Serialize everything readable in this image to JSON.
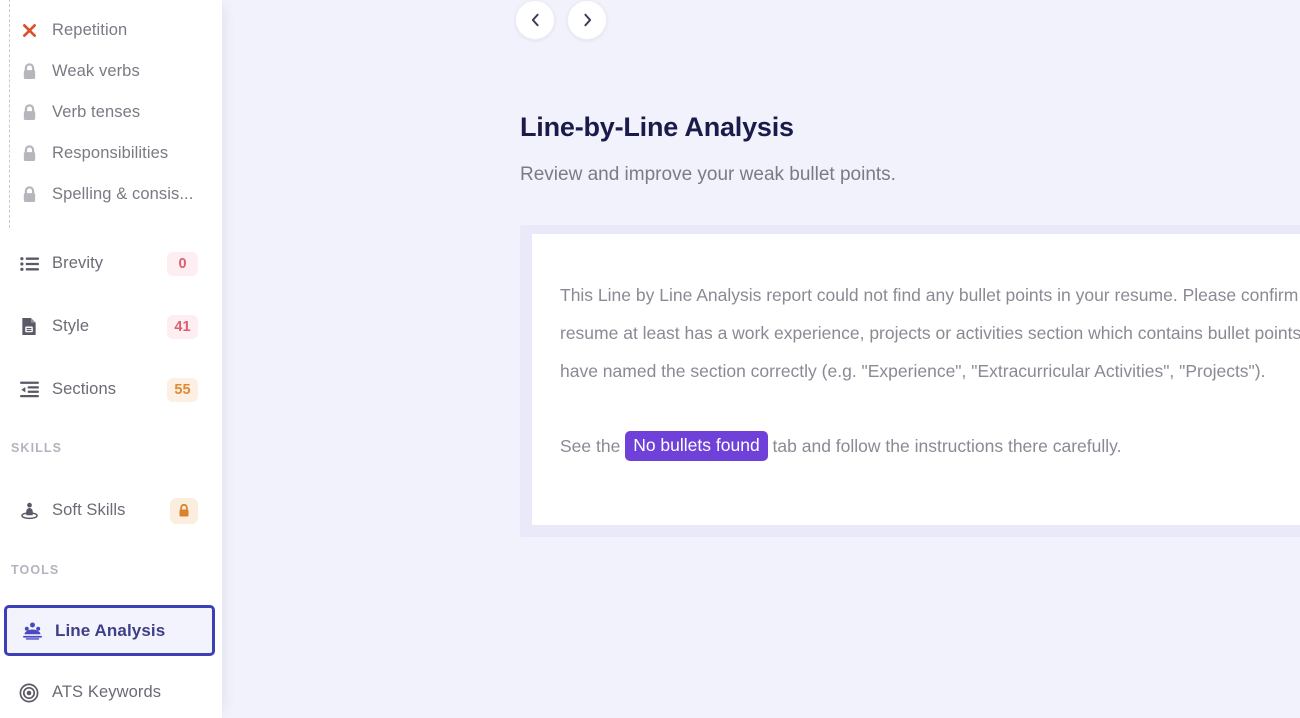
{
  "sidebar": {
    "locked_group": [
      {
        "label": "Repetition",
        "icon": "x-mark-icon",
        "state": "error"
      },
      {
        "label": "Weak verbs",
        "icon": "lock-icon",
        "state": "locked"
      },
      {
        "label": "Verb tenses",
        "icon": "lock-icon",
        "state": "locked"
      },
      {
        "label": "Responsibilities",
        "icon": "lock-icon",
        "state": "locked"
      },
      {
        "label": "Spelling & consis...",
        "icon": "lock-icon",
        "state": "locked"
      }
    ],
    "score_group": [
      {
        "label": "Brevity",
        "icon": "bulleted-list-icon",
        "badge": "0",
        "badge_style": "pink"
      },
      {
        "label": "Style",
        "icon": "document-icon",
        "badge": "41",
        "badge_style": "pink"
      },
      {
        "label": "Sections",
        "icon": "indent-icon",
        "badge": "55",
        "badge_style": "orange"
      }
    ],
    "skills_header": "SKILLS",
    "skills_group": [
      {
        "label": "Soft Skills",
        "icon": "person-pin-icon",
        "badge": "lock-icon",
        "badge_style": "lockbox"
      }
    ],
    "tools_header": "TOOLS",
    "tools_group": [
      {
        "label": "Line Analysis",
        "icon": "line-analysis-icon",
        "selected": true
      },
      {
        "label": "ATS Keywords",
        "icon": "target-icon",
        "selected": false
      }
    ]
  },
  "nav": {
    "prev_icon": "chevron-left-icon",
    "next_icon": "chevron-right-icon"
  },
  "header": {
    "title": "Line-by-Line Analysis",
    "subtitle": "Review and improve your weak bullet points."
  },
  "card": {
    "paragraph_1": "This Line by Line Analysis report could not find any bullet points in your resume. Please confirm that your resume at least has a work experience, projects or activities section which contains bullet points, and that you have named the section correctly (e.g. \"Experience\", \"Extracurricular Activities\", \"Projects\").",
    "paragraph_2_before": "See the ",
    "tab_chip": "No bullets found",
    "paragraph_2_after": " tab and follow the instructions there carefully."
  },
  "colors": {
    "page_background": "#f2f2fc",
    "sidebar_background": "#ffffff",
    "accent_indigo": "#3d3fb5",
    "title_navy": "#1b1b4b",
    "chip_purple": "#6f41d8",
    "badge_pink_text": "#e05c73",
    "badge_pink_bg": "#fdeef1",
    "badge_orange_text": "#e08a37",
    "badge_orange_bg": "#fdf0e2",
    "error_red": "#d9512c",
    "lock_grey": "#b6b6bd"
  }
}
